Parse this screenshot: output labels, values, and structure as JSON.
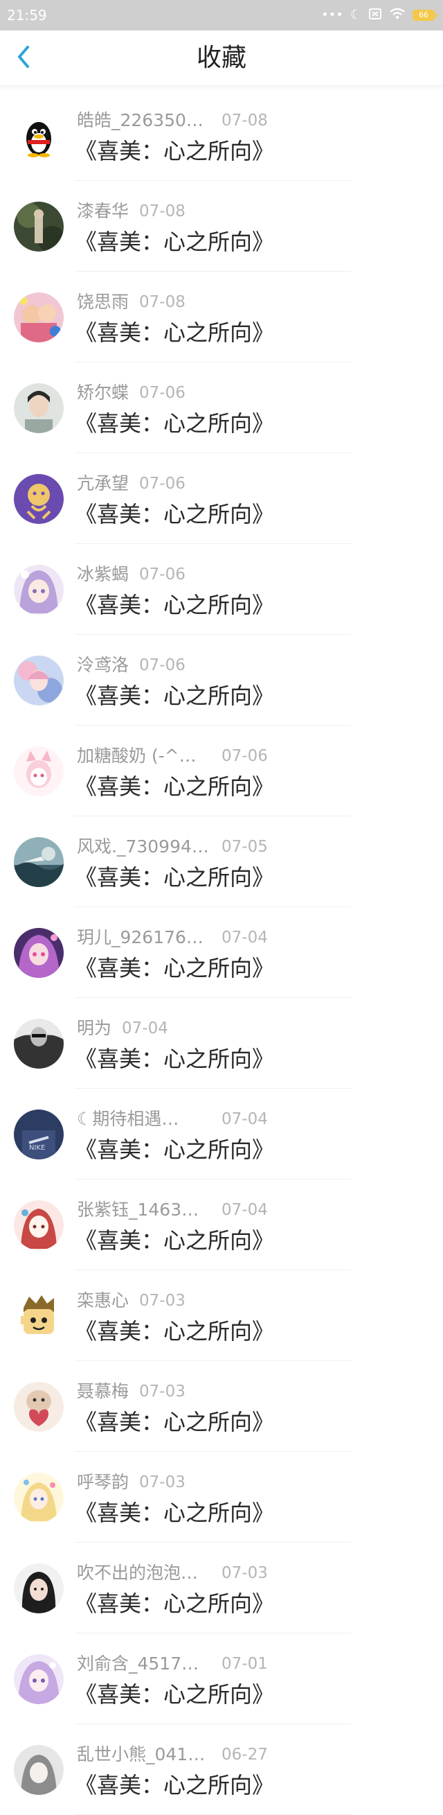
{
  "status_bar": {
    "time": "21:59",
    "battery": "66",
    "icons": [
      "more-dots-icon",
      "moon-icon",
      "sim-off-icon",
      "wifi-icon",
      "battery-icon"
    ]
  },
  "header": {
    "title": "收藏",
    "back_icon": "chevron-left-icon",
    "accent": "#2aa3d8"
  },
  "colors": {
    "name": "#9a9a9a",
    "date": "#b5b5b5",
    "title": "#2a2a2a",
    "status_bar_bg": "#cfcfcf"
  },
  "favorites": [
    {
      "name": "皓皓_226350…",
      "date": "07-08",
      "title": "《喜美：心之所向》",
      "avatar": "qq-penguin"
    },
    {
      "name": "漆春华",
      "date": "07-08",
      "title": "《喜美：心之所向》",
      "avatar": "photo-dark-green"
    },
    {
      "name": "饶思雨",
      "date": "07-08",
      "title": "《喜美：心之所向》",
      "avatar": "photo-kids"
    },
    {
      "name": "矫尔蝶",
      "date": "07-06",
      "title": "《喜美：心之所向》",
      "avatar": "photo-portrait"
    },
    {
      "name": "亢承望",
      "date": "07-06",
      "title": "《喜美：心之所向》",
      "avatar": "cartoon-purple"
    },
    {
      "name": "冰紫蝎",
      "date": "07-06",
      "title": "《喜美：心之所向》",
      "avatar": "anime-lavender"
    },
    {
      "name": "泠鸢洛",
      "date": "07-06",
      "title": "《喜美：心之所向》",
      "avatar": "anime-blue-pink"
    },
    {
      "name": "加糖酸奶 (-^…",
      "date": "07-06",
      "title": "《喜美：心之所向》",
      "avatar": "anime-pink-cat"
    },
    {
      "name": "风戏._730994…",
      "date": "07-05",
      "title": "《喜美：心之所向》",
      "avatar": "photo-sea"
    },
    {
      "name": "玥儿_926176…",
      "date": "07-04",
      "title": "《喜美：心之所向》",
      "avatar": "anime-purple"
    },
    {
      "name": "明为",
      "date": "07-04",
      "title": "《喜美：心之所向》",
      "avatar": "photo-bw"
    },
    {
      "name": "☾期待相遇…",
      "date": "07-04",
      "title": "《喜美：心之所向》",
      "avatar": "photo-navy"
    },
    {
      "name": "张紫钰_1463…",
      "date": "07-04",
      "title": "《喜美：心之所向》",
      "avatar": "anime-red-white"
    },
    {
      "name": "栾惠心",
      "date": "07-03",
      "title": "《喜美：心之所向》",
      "avatar": "cartoon-face"
    },
    {
      "name": "聂慕梅",
      "date": "07-03",
      "title": "《喜美：心之所向》",
      "avatar": "cartoon-heart"
    },
    {
      "name": "呼琴韵",
      "date": "07-03",
      "title": "《喜美：心之所向》",
      "avatar": "anime-yellow"
    },
    {
      "name": "吹不出的泡泡…",
      "date": "07-03",
      "title": "《喜美：心之所向》",
      "avatar": "photo-girl"
    },
    {
      "name": "刘俞含_4517…",
      "date": "07-01",
      "title": "《喜美：心之所向》",
      "avatar": "anime-lilac"
    },
    {
      "name": "乱世小熊_041…",
      "date": "06-27",
      "title": "《喜美：心之所向》",
      "avatar": "anime-gray"
    }
  ]
}
